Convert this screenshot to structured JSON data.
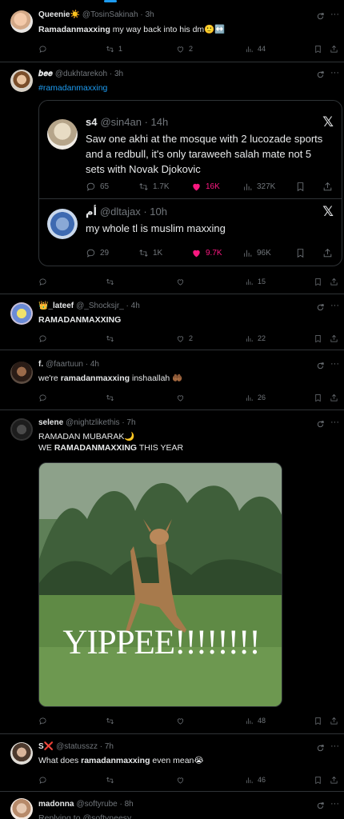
{
  "colors": {
    "background": "#000000",
    "accent": "#1d9bf0",
    "like": "#f91880",
    "muted": "#71767b",
    "divider": "#2f3336"
  },
  "tweets": [
    {
      "name": "Queenie☀️",
      "handle": "@TosinSakinah · 3h",
      "text_bold": "Ramadanmaxxing",
      "text_rest": " my way back into his dm🙂↔️",
      "retweets": "1",
      "likes": "2",
      "views": "44"
    },
    {
      "name": "𝒃𝒆𝒆",
      "handle": "@dukhtarekoh · 3h",
      "text": "#ramadanmaxxing",
      "retweets": "",
      "likes": "",
      "views": "15",
      "quotes": [
        {
          "name": "s4",
          "handle": "@sin4an · 14h",
          "text": "Saw one akhi at the mosque with 2 lucozade sports and a redbull, it's only taraweeh salah mate not 5 sets with Novak Djokovic",
          "replies": "65",
          "retweets": "1.7K",
          "likes": "16K",
          "views": "327K"
        },
        {
          "name": "أم",
          "handle": "@dltajax · 10h",
          "text": "my whole tl is muslim maxxing",
          "replies": "29",
          "retweets": "1K",
          "likes": "9.7K",
          "views": "96K"
        }
      ]
    },
    {
      "name": "👑_lateef",
      "handle": "@_Shocksjr_ · 4h",
      "text": "RAMADANMAXXING",
      "retweets": "",
      "likes": "2",
      "views": "22"
    },
    {
      "name": "f.",
      "handle": "@faartuun · 4h",
      "text_pre": "we're ",
      "text_bold": "ramadanmaxxing",
      "text_rest": " inshaallah 🤲🏾",
      "retweets": "",
      "likes": "",
      "views": "26"
    },
    {
      "name": "selene",
      "handle": "@nightzlikethis · 7h",
      "text_line1": "RAMADAN MUBARAK🌙",
      "text_line2_pre": "WE ",
      "text_line2_bold": "RAMADANMAXXING",
      "text_line2_rest": " THIS YEAR",
      "media_caption": "YIPPEE!!!!!!!!",
      "retweets": "",
      "likes": "",
      "views": "48"
    },
    {
      "name": "S❌",
      "handle": "@statusszz · 7h",
      "text_pre": "What does ",
      "text_bold": "ramadanmaxxing",
      "text_rest": " even mean😭",
      "retweets": "",
      "likes": "",
      "views": "46"
    },
    {
      "name": "madonna",
      "handle": "@softyrube · 8h",
      "text": "Replying to @softyneesy"
    }
  ]
}
